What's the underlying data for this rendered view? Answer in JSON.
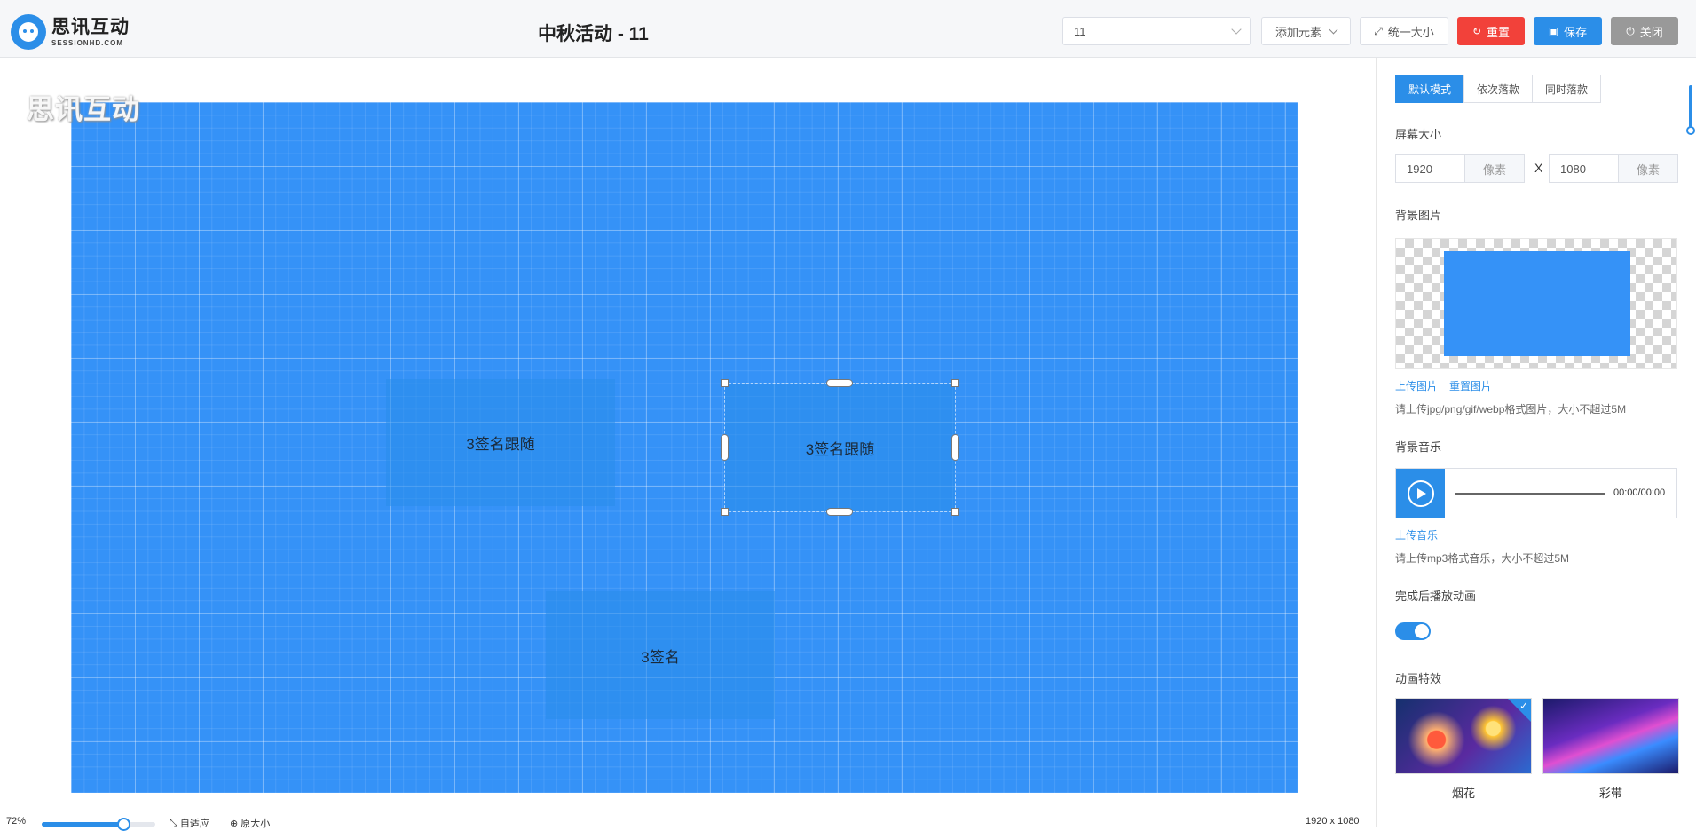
{
  "header": {
    "logo_cn": "思讯互动",
    "logo_en": "SESSIONHD.COM",
    "title": "中秋活动 - 11",
    "select_value": "11",
    "add_element_label": "添加元素",
    "unify_size_label": "统一大小",
    "reset_label": "重置",
    "save_label": "保存",
    "close_label": "关闭",
    "reset_color": "#f2413a",
    "save_color": "#2b8ee8",
    "close_color": "#999999"
  },
  "canvas": {
    "watermark": "思讯互动",
    "background_color": "#3592f7",
    "elements": [
      {
        "label": "3签名跟随",
        "selected": false
      },
      {
        "label": "3签名跟随",
        "selected": true
      },
      {
        "label": "3签名",
        "selected": false
      }
    ]
  },
  "zoombar": {
    "zoom": "72%",
    "zoom_fraction": 0.72,
    "fit_label": "自适应",
    "original_label": "原大小",
    "resolution": "1920 x 1080"
  },
  "panel": {
    "modes": [
      "默认模式",
      "依次落款",
      "同时落款"
    ],
    "active_mode": "默认模式",
    "screen_size_label": "屏幕大小",
    "width": "1920",
    "height": "1080",
    "unit": "像素",
    "x_sep": "X",
    "bg_image_label": "背景图片",
    "upload_image": "上传图片",
    "reset_image": "重置图片",
    "image_hint": "请上传jpg/png/gif/webp格式图片，大小不超过5M",
    "bg_music_label": "背景音乐",
    "audio_time": "00:00/00:00",
    "upload_music": "上传音乐",
    "music_hint": "请上传mp3格式音乐，大小不超过5M",
    "play_anim_label": "完成后播放动画",
    "play_anim_on": true,
    "effect_label": "动画特效",
    "effects": [
      {
        "name": "烟花",
        "selected": true
      },
      {
        "name": "彩带",
        "selected": false
      }
    ],
    "accent_color": "#2b8ee8"
  }
}
